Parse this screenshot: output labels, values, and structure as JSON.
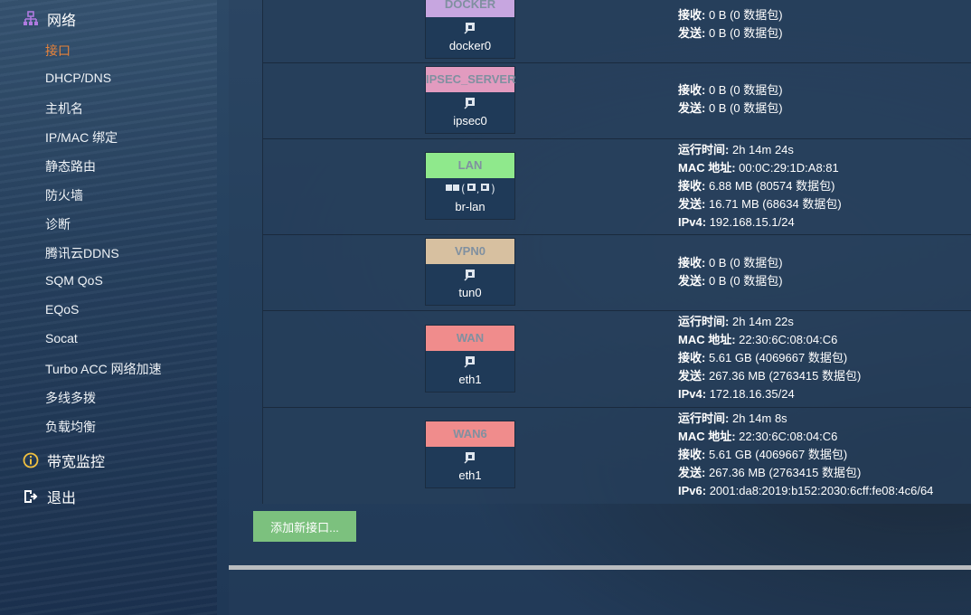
{
  "sidebar": {
    "network_section": "网络",
    "items": [
      {
        "label": "接口",
        "active": true
      },
      {
        "label": "DHCP/DNS"
      },
      {
        "label": "主机名"
      },
      {
        "label": "IP/MAC 绑定"
      },
      {
        "label": "静态路由"
      },
      {
        "label": "防火墙"
      },
      {
        "label": "诊断"
      },
      {
        "label": "腾讯云DDNS"
      },
      {
        "label": "SQM QoS"
      },
      {
        "label": "EQoS"
      },
      {
        "label": "Socat"
      },
      {
        "label": "Turbo ACC 网络加速"
      },
      {
        "label": "多线多拨"
      },
      {
        "label": "负载均衡"
      }
    ],
    "bandwidth_section": "带宽监控",
    "logout": "退出"
  },
  "interfaces": [
    {
      "name": "DOCKER",
      "color": "#c7a6e0",
      "device": "docker0",
      "rx_label": "接收:",
      "rx": "0 B (0 数据包)",
      "tx_label": "发送:",
      "tx": "0 B (0 数据包)"
    },
    {
      "name": "IPSEC_SERVER",
      "color": "#e29bbf",
      "device": "ipsec0",
      "rx_label": "接收:",
      "rx": "0 B (0 数据包)",
      "tx_label": "发送:",
      "tx": "0 B (0 数据包)"
    },
    {
      "name": "LAN",
      "color": "#8fe98c",
      "device": "br-lan",
      "uptime_label": "运行时间:",
      "uptime": "2h 14m 24s",
      "mac_label": "MAC 地址:",
      "mac": "00:0C:29:1D:A8:81",
      "rx_label": "接收:",
      "rx": "6.88 MB (80574 数据包)",
      "tx_label": "发送:",
      "tx": "16.71 MB (68634 数据包)",
      "ip_label": "IPv4:",
      "ip": "192.168.15.1/24"
    },
    {
      "name": "VPN0",
      "color": "#d7c0a0",
      "device": "tun0",
      "rx_label": "接收:",
      "rx": "0 B (0 数据包)",
      "tx_label": "发送:",
      "tx": "0 B (0 数据包)"
    },
    {
      "name": "WAN",
      "color": "#f08c8c",
      "device": "eth1",
      "uptime_label": "运行时间:",
      "uptime": "2h 14m 22s",
      "mac_label": "MAC 地址:",
      "mac": "22:30:6C:08:04:C6",
      "rx_label": "接收:",
      "rx": "5.61 GB (4069667 数据包)",
      "tx_label": "发送:",
      "tx": "267.36 MB (2763415 数据包)",
      "ip_label": "IPv4:",
      "ip": "172.18.16.35/24"
    },
    {
      "name": "WAN6",
      "color": "#f08c8c",
      "device": "eth1",
      "uptime_label": "运行时间:",
      "uptime": "2h 14m 8s",
      "mac_label": "MAC 地址:",
      "mac": "22:30:6C:08:04:C6",
      "rx_label": "接收:",
      "rx": "5.61 GB (4069667 数据包)",
      "tx_label": "发送:",
      "tx": "267.36 MB (2763415 数据包)",
      "ip_label": "IPv6:",
      "ip": "2001:da8:2019:b152:2030:6cff:fe08:4c6/64"
    }
  ],
  "add_button": "添加新接口...",
  "colors": {
    "active": "#e8833a",
    "add_button": "#7cc17e"
  }
}
